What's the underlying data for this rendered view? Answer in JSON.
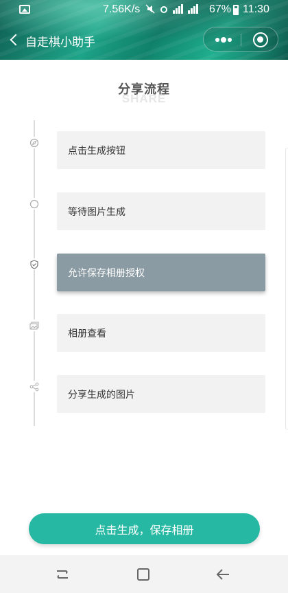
{
  "status_bar": {
    "speed": "7.56K/s",
    "battery": "67%",
    "time": "11:30",
    "icons": [
      "gallery-icon",
      "mute-icon",
      "alarm-icon",
      "signal-icon",
      "4g-icon",
      "battery-icon"
    ]
  },
  "nav": {
    "title": "自走棋小助手"
  },
  "page": {
    "title": "分享流程",
    "subtitle": "SHARE"
  },
  "steps": [
    {
      "label": "点击生成按钮",
      "icon": "compass-icon",
      "active": false
    },
    {
      "label": "等待图片生成",
      "icon": "circle-icon",
      "active": false
    },
    {
      "label": "允许保存相册授权",
      "icon": "shield-check-icon",
      "active": true
    },
    {
      "label": "相册查看",
      "icon": "photo-album-icon",
      "active": false
    },
    {
      "label": "分享生成的图片",
      "icon": "share-icon",
      "active": false
    }
  ],
  "primary_button": {
    "label": "点击生成，保存相册"
  },
  "colors": {
    "accent": "#26b8a2",
    "active_step": "#8a9ba3",
    "step_bg": "#f2f2f2"
  }
}
